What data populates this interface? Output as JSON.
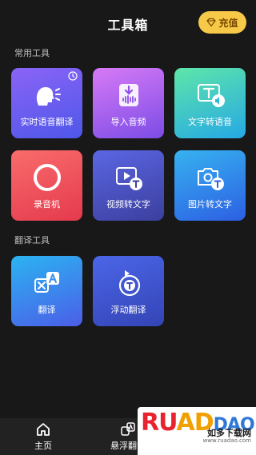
{
  "header": {
    "title": "工具箱",
    "charge_label": "充值"
  },
  "sections": {
    "common": "常用工具",
    "translate": "翻译工具"
  },
  "cards": {
    "realtime": "实时语音翻译",
    "import_audio": "导入音频",
    "text_to_speech": "文字转语音",
    "recorder": "录音机",
    "video_to_text": "视频转文字",
    "image_to_text": "图片转文字",
    "translate": "翻译",
    "float_translate": "浮动翻译"
  },
  "nav": {
    "home": "主页",
    "float": "悬浮翻译"
  },
  "watermark": {
    "logo": "RUAN DADO",
    "sub": "如多下载网",
    "url": "www.ruadao.com"
  }
}
